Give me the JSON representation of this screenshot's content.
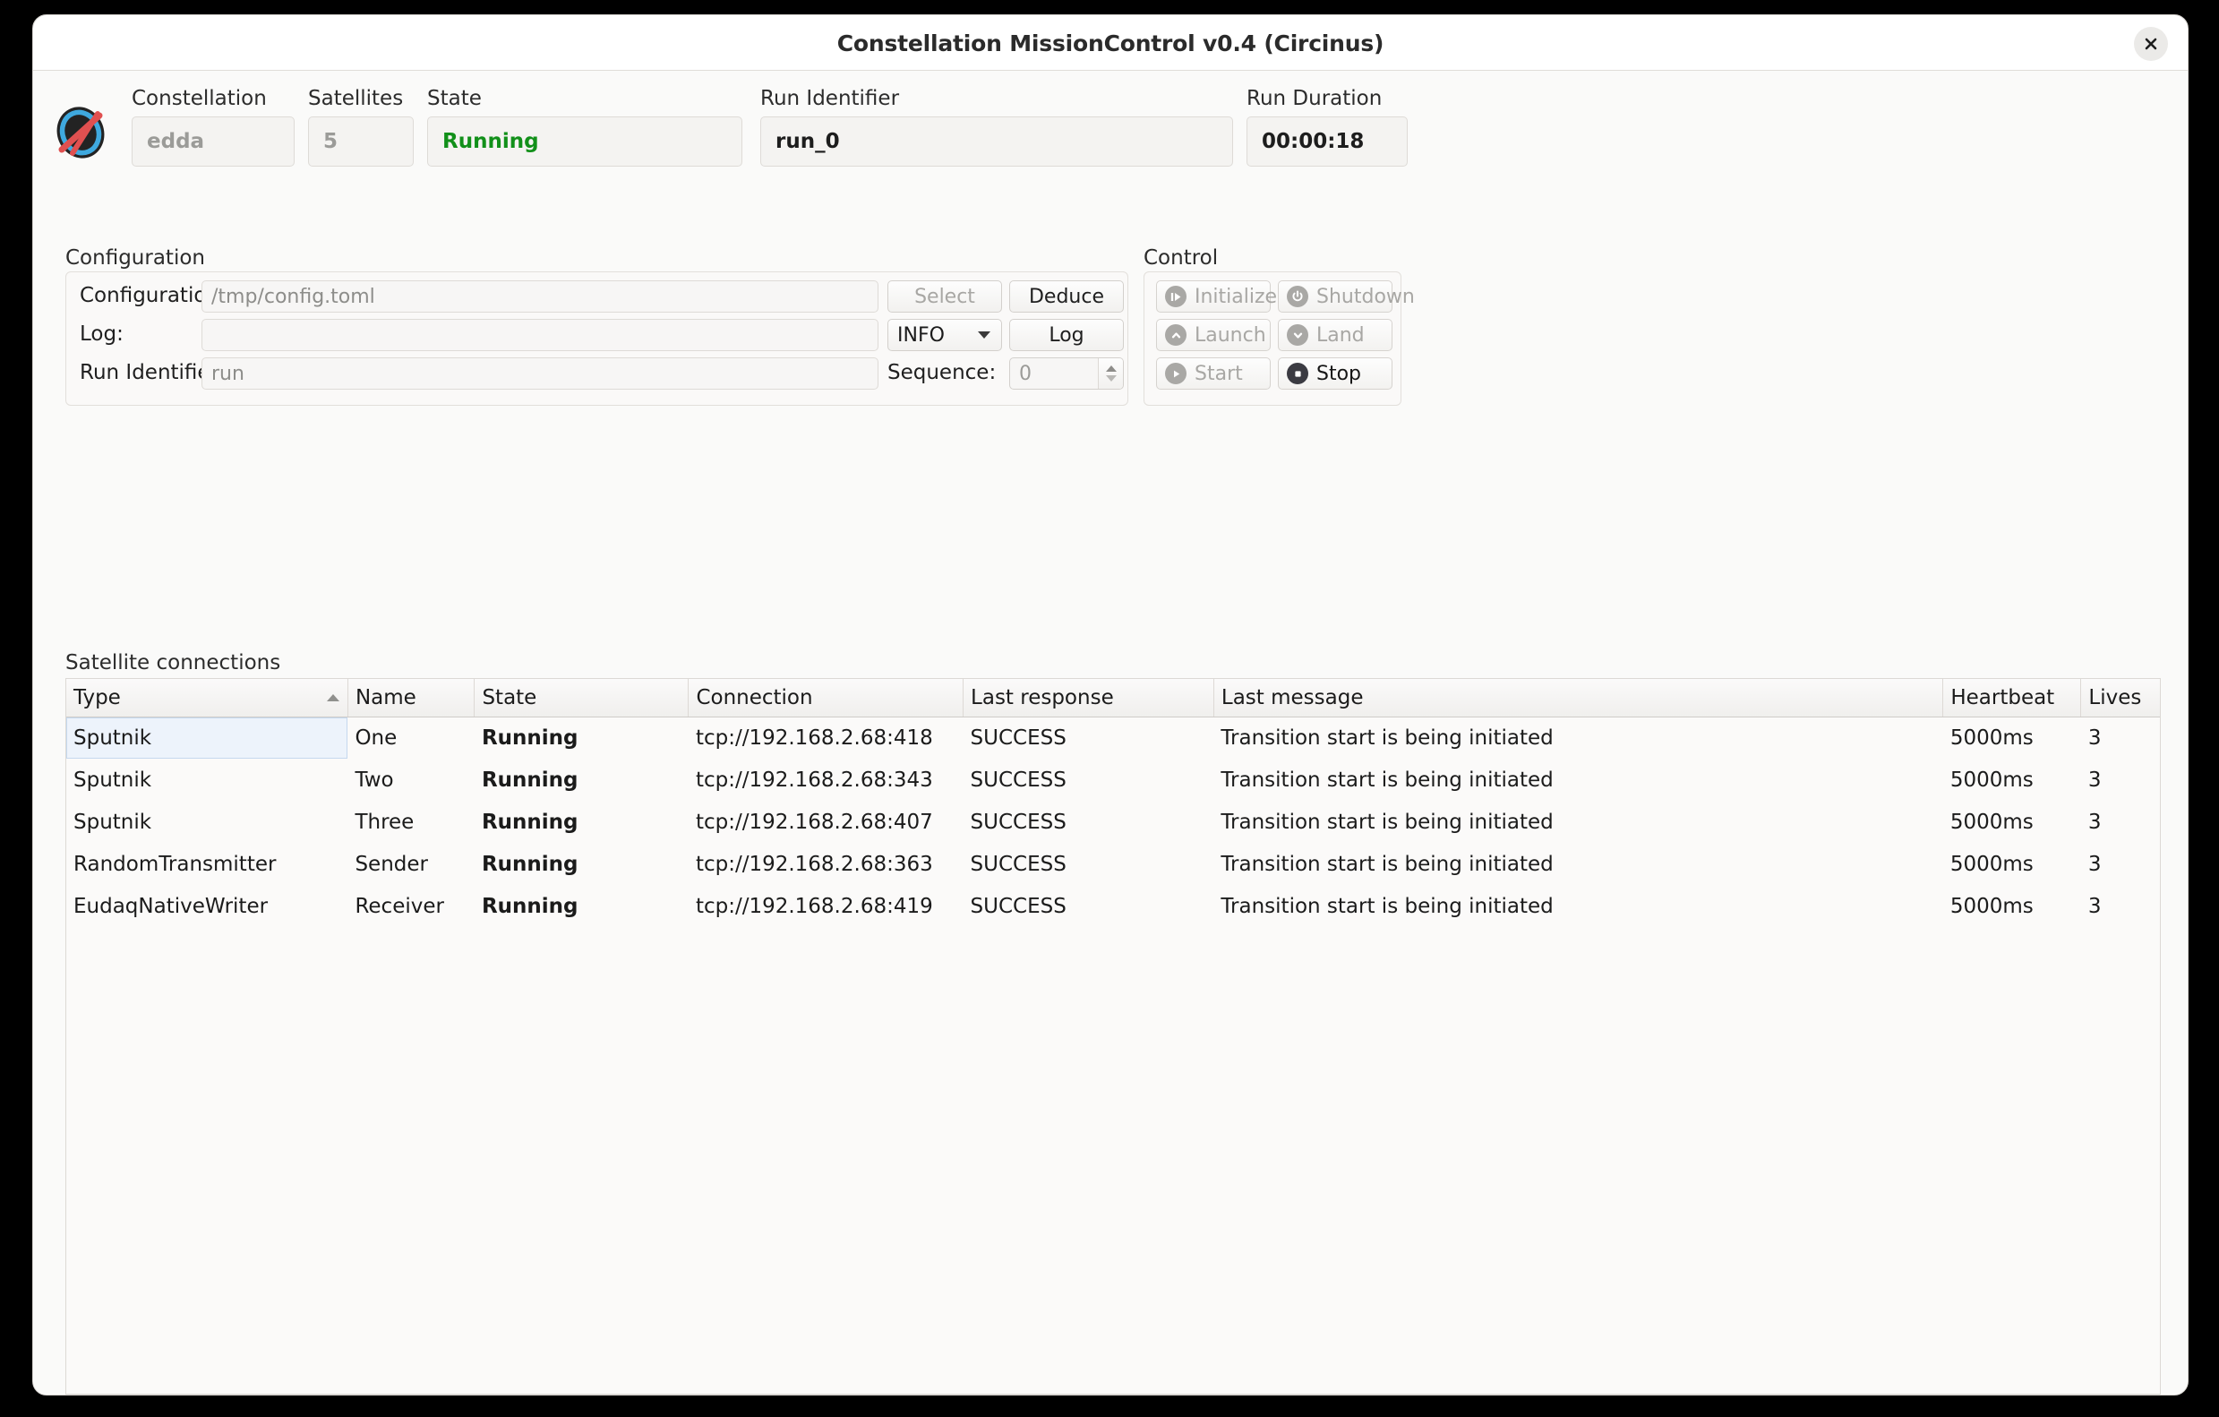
{
  "window": {
    "title": "Constellation MissionControl v0.4 (Circinus)",
    "close_icon": "close-icon"
  },
  "status": {
    "logo_icon": "constellation-logo-icon",
    "constellation": {
      "label": "Constellation",
      "value": "edda"
    },
    "satellites": {
      "label": "Satellites",
      "value": "5"
    },
    "state": {
      "label": "State",
      "value": "Running"
    },
    "run_identifier": {
      "label": "Run Identifier",
      "value": "run_0"
    },
    "run_duration": {
      "label": "Run Duration",
      "value": "00:00:18"
    }
  },
  "configuration": {
    "group_title": "Configuration",
    "rows": {
      "config": {
        "label": "Configuration:",
        "placeholder": "/tmp/config.toml"
      },
      "log": {
        "label": "Log:",
        "placeholder": ""
      },
      "run_id": {
        "label": "Run Identifier:",
        "placeholder": "run"
      }
    },
    "select_button": "Select",
    "deduce_button": "Deduce",
    "log_button": "Log",
    "log_level": "INFO",
    "sequence_label": "Sequence:",
    "sequence_value": "0"
  },
  "control": {
    "group_title": "Control",
    "buttons": [
      {
        "label": "Initialize",
        "icon": "initialize-icon",
        "enabled": false
      },
      {
        "label": "Shutdown",
        "icon": "power-icon",
        "enabled": false
      },
      {
        "label": "Launch",
        "icon": "chevron-up-icon",
        "enabled": false
      },
      {
        "label": "Land",
        "icon": "chevron-down-icon",
        "enabled": false
      },
      {
        "label": "Start",
        "icon": "play-icon",
        "enabled": false
      },
      {
        "label": "Stop",
        "icon": "stop-icon",
        "enabled": true
      }
    ]
  },
  "satellite_table": {
    "title": "Satellite connections",
    "sorted_column": "Type",
    "sort_direction": "ascending",
    "columns": [
      "Type",
      "Name",
      "State",
      "Connection",
      "Last response",
      "Last message",
      "Heartbeat",
      "Lives"
    ],
    "rows": [
      {
        "type": "Sputnik",
        "name": "One",
        "state": "Running",
        "connection": "tcp://192.168.2.68:418",
        "last_response": "SUCCESS",
        "last_message": "Transition start is being initiated",
        "heartbeat": "5000ms",
        "lives": "3",
        "selected": true
      },
      {
        "type": "Sputnik",
        "name": "Two",
        "state": "Running",
        "connection": "tcp://192.168.2.68:343",
        "last_response": "SUCCESS",
        "last_message": "Transition start is being initiated",
        "heartbeat": "5000ms",
        "lives": "3",
        "selected": false
      },
      {
        "type": "Sputnik",
        "name": "Three",
        "state": "Running",
        "connection": "tcp://192.168.2.68:407",
        "last_response": "SUCCESS",
        "last_message": "Transition start is being initiated",
        "heartbeat": "5000ms",
        "lives": "3",
        "selected": false
      },
      {
        "type": "RandomTransmitter",
        "name": "Sender",
        "state": "Running",
        "connection": "tcp://192.168.2.68:363",
        "last_response": "SUCCESS",
        "last_message": "Transition start is being initiated",
        "heartbeat": "5000ms",
        "lives": "3",
        "selected": false
      },
      {
        "type": "EudaqNativeWriter",
        "name": "Receiver",
        "state": "Running",
        "connection": "tcp://192.168.2.68:419",
        "last_response": "SUCCESS",
        "last_message": "Transition start is being initiated",
        "heartbeat": "5000ms",
        "lives": "3",
        "selected": false
      }
    ]
  },
  "colors": {
    "running_green": "#12901a",
    "success_green": "#2f9e2f",
    "window_bg": "#fafaf9",
    "selection_blue": "#edf3fb"
  }
}
